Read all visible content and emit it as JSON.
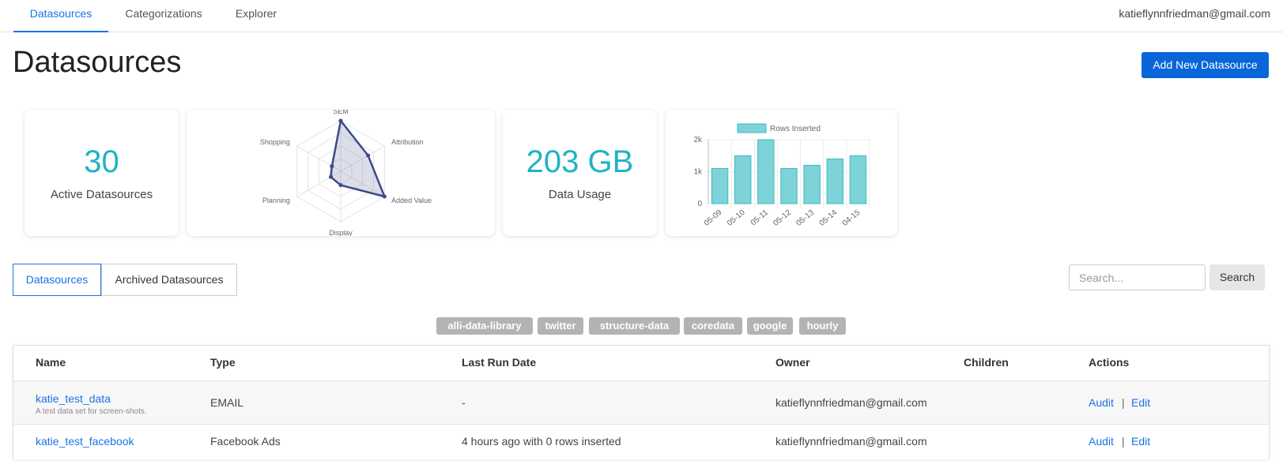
{
  "nav": {
    "tabs": [
      "Datasources",
      "Categorizations",
      "Explorer"
    ],
    "active_tab": "Datasources",
    "user_email": "katieflynnfriedman@gmail.com"
  },
  "page": {
    "title": "Datasources",
    "add_button": "Add New Datasource"
  },
  "stats": {
    "active_count": "30",
    "active_label": "Active Datasources",
    "usage_value": "203 GB",
    "usage_label": "Data Usage"
  },
  "colors": {
    "accent": "#1a73e8",
    "stat_teal": "#1fb3c4",
    "radar_line": "#3d4a8a",
    "bar_fill": "#7dd3d8",
    "bar_stroke": "#3cb9c2",
    "tag_bg": "#b3b3b3"
  },
  "chart_data": [
    {
      "type": "radar",
      "categories": [
        "SEM",
        "Attribution",
        "Added Value",
        "Display",
        "Planning",
        "Shopping"
      ],
      "values": [
        4,
        2.5,
        4,
        1.1,
        0.9,
        0.8
      ],
      "rmax": 4
    },
    {
      "type": "bar",
      "categories": [
        "05-09",
        "05-10",
        "05-11",
        "05-12",
        "05-13",
        "05-14",
        "04-15"
      ],
      "series": [
        {
          "name": "Rows Inserted",
          "values": [
            1100,
            1500,
            2000,
            1100,
            1200,
            1400,
            1500
          ]
        }
      ],
      "ylim": [
        0,
        2000
      ],
      "yticks": [
        "0",
        "1k",
        "2k"
      ],
      "legend": "top"
    }
  ],
  "segments": {
    "datasources": "Datasources",
    "archived": "Archived Datasources"
  },
  "search": {
    "placeholder": "Search...",
    "button": "Search"
  },
  "tags": [
    "alli-data-library",
    "twitter",
    "structure-data",
    "coredata",
    "google",
    "hourly"
  ],
  "table": {
    "headers": [
      "Name",
      "Type",
      "Last Run Date",
      "Owner",
      "Children",
      "Actions"
    ],
    "rows": [
      {
        "name": "katie_test_data",
        "description": "A test data set for screen-shots.",
        "type": "EMAIL",
        "last_run": "-",
        "owner": "katieflynnfriedman@gmail.com",
        "children": "",
        "audit": "Audit",
        "separator": "|",
        "edit": "Edit"
      },
      {
        "name": "katie_test_facebook",
        "type": "Facebook Ads",
        "last_run": "4 hours ago with 0 rows inserted",
        "owner": "katieflynnfriedman@gmail.com",
        "children": "",
        "audit": "Audit",
        "separator": "|",
        "edit": "Edit"
      }
    ]
  }
}
